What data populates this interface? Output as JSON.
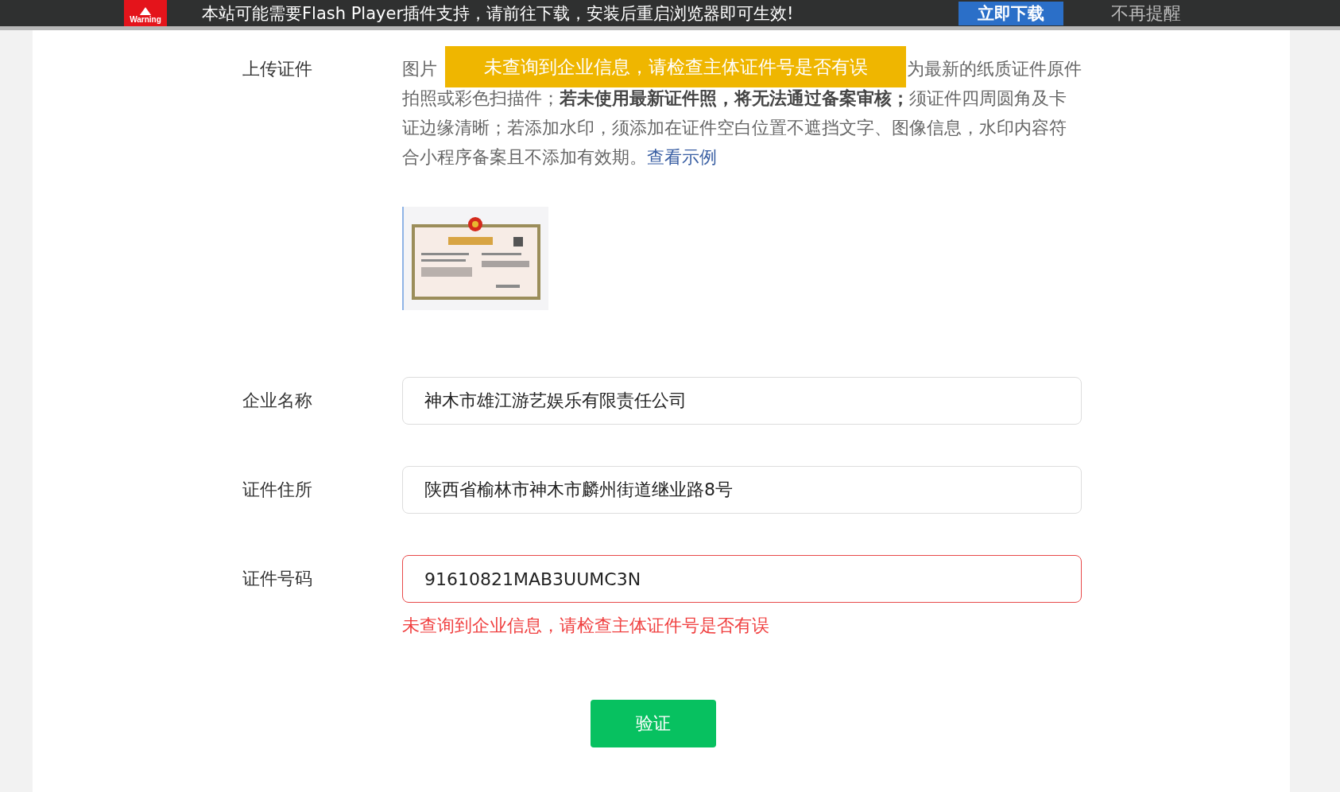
{
  "notice_bar": {
    "badge": "Warning",
    "message": "本站可能需要Flash Player插件支持，请前往下载，安装后重启浏览器即可生效!",
    "download_button": "立即下载",
    "dismiss_link": "不再提醒"
  },
  "toast": {
    "message": "未查询到企业信息，请检查主体证件号是否有误"
  },
  "upload": {
    "label": "上传证件",
    "hint_start": "图片",
    "hint_end": "为最新的纸质证件原件",
    "hint_body": "拍照或彩色扫描件；**若未使用最新证件照，将无法通过备案审核；**须证件四周圆角及卡证边缘清晰；若添加水印，须添加在证件空白位置不遮挡文字、图像信息，水印内容符合小程序备案且不添加有效期。",
    "example_link": "查看示例"
  },
  "fields": [
    {
      "label": "企业名称",
      "value": "神木市雄江游艺娱乐有限责任公司",
      "error": false
    },
    {
      "label": "证件住所",
      "value": "陕西省榆林市神木市麟州街道继业路8号",
      "error": false
    },
    {
      "label": "证件号码",
      "value": "91610821MAB3UUMC3N",
      "error": true,
      "error_message": "未查询到企业信息，请检查主体证件号是否有误"
    }
  ],
  "submit_button": "验证"
}
